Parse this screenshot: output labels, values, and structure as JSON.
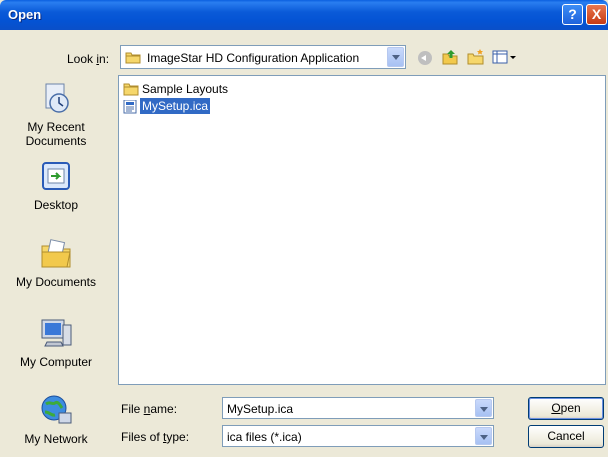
{
  "window": {
    "title": "Open"
  },
  "title_buttons": {
    "help": "?",
    "close": "X"
  },
  "lookin": {
    "label_pre": "Look ",
    "label_u": "i",
    "label_post": "n:",
    "value": "ImageStar HD Configuration Application"
  },
  "toolbar": {
    "icons": [
      "back-icon",
      "up-folder-icon",
      "new-folder-icon",
      "views-menu-icon"
    ]
  },
  "places": [
    {
      "name": "my-recent-documents",
      "line1": "My Recent",
      "line2": "Documents"
    },
    {
      "name": "desktop",
      "line1": "Desktop",
      "line2": ""
    },
    {
      "name": "my-documents",
      "line1": "My Documents",
      "line2": ""
    },
    {
      "name": "my-computer",
      "line1": "My Computer",
      "line2": ""
    },
    {
      "name": "my-network",
      "line1": "My Network",
      "line2": ""
    }
  ],
  "files": [
    {
      "label": "Sample Layouts",
      "type": "folder",
      "selected": false
    },
    {
      "label": "MySetup.ica",
      "type": "file",
      "selected": true
    }
  ],
  "filename": {
    "label_pre": "File ",
    "label_u": "n",
    "label_post": "ame:",
    "value": "MySetup.ica"
  },
  "filetype": {
    "label_pre": "Files of ",
    "label_u": "t",
    "label_post": "ype:",
    "value": "ica files (*.ica)"
  },
  "buttons": {
    "open_u": "O",
    "open_rest": "pen",
    "cancel": "Cancel"
  },
  "colors": {
    "titlebar": "#0453d4",
    "selection": "#316ac5",
    "dialog_bg": "#ece9d8"
  }
}
